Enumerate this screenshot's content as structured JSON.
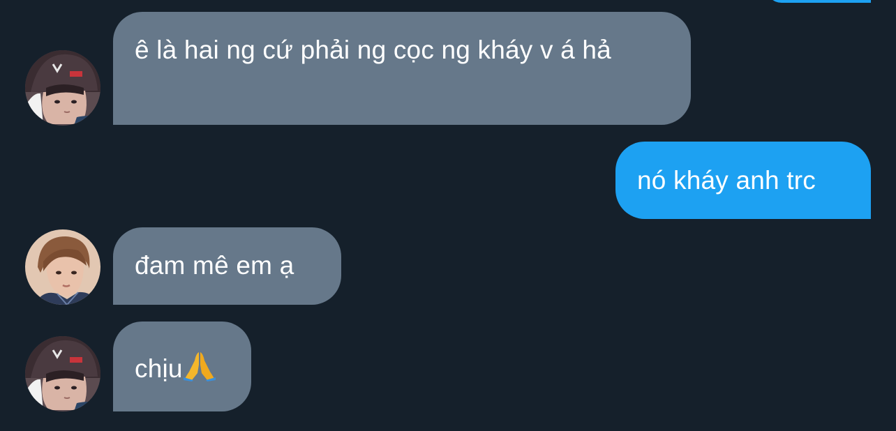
{
  "thread": {
    "messages": [
      {
        "side": "incoming",
        "text": "ê là hai ng cứ phải ng cọc ng kháy v á hả"
      },
      {
        "side": "outgoing",
        "text": "nó kháy anh trc"
      },
      {
        "side": "incoming",
        "text": "đam mê em ạ"
      },
      {
        "side": "incoming",
        "text": "chịu",
        "emoji": "folded-hands"
      }
    ]
  },
  "colors": {
    "background": "#15202b",
    "incoming_bubble": "#66788a",
    "outgoing_bubble": "#1da1f2",
    "text": "#ffffff"
  },
  "icons": {
    "avatar_1": "avatar-beanie-user",
    "avatar_2": "avatar-brown-hair-user",
    "avatar_3": "avatar-beanie-user"
  }
}
